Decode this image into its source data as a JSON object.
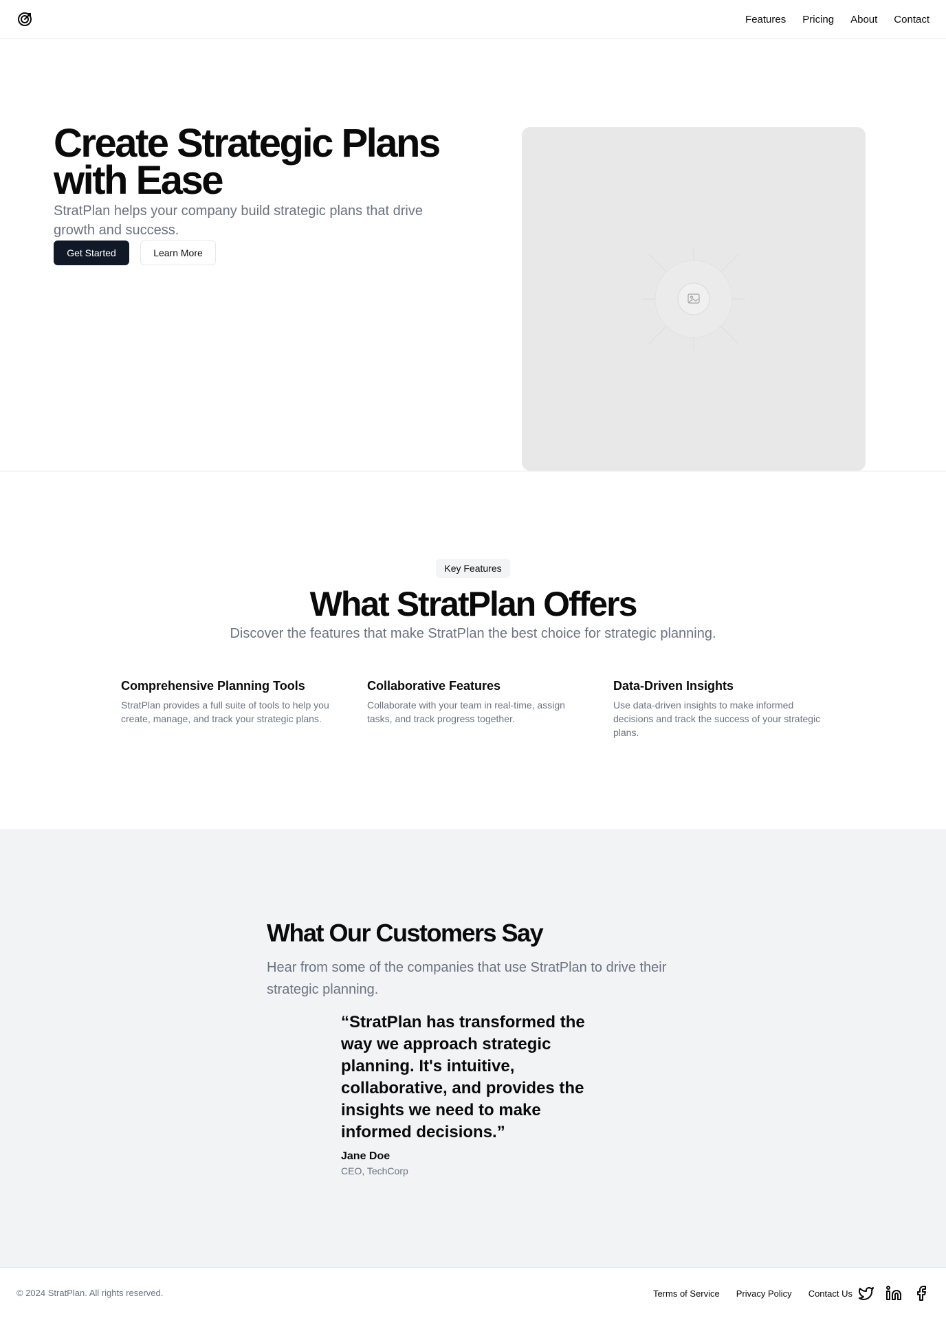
{
  "header": {
    "logo_icon": "crosshair-logo-icon",
    "nav": [
      "Features",
      "Pricing",
      "About",
      "Contact"
    ]
  },
  "hero": {
    "title": "Create Strategic Plans with Ease",
    "subtitle": "StratPlan helps your company build strategic plans that drive growth and success.",
    "primary_button": "Get Started",
    "secondary_button": "Learn More",
    "image_icon": "image-placeholder-icon"
  },
  "features": {
    "badge": "Key Features",
    "title": "What StratPlan Offers",
    "subtitle": "Discover the features that make StratPlan the best choice for strategic planning.",
    "items": [
      {
        "title": "Comprehensive Planning Tools",
        "description": "StratPlan provides a full suite of tools to help you create, manage, and track your strategic plans."
      },
      {
        "title": "Collaborative Features",
        "description": "Collaborate with your team in real-time, assign tasks, and track progress together."
      },
      {
        "title": "Data-Driven Insights",
        "description": "Use data-driven insights to make informed decisions and track the success of your strategic plans."
      }
    ]
  },
  "testimonials": {
    "title": "What Our Customers Say",
    "subtitle": "Hear from some of the companies that use StratPlan to drive their strategic planning.",
    "quote": "“StratPlan has transformed the way we approach strategic planning. It's intuitive, collaborative, and provides the insights we need to make informed decisions.”",
    "author": "Jane Doe",
    "role": "CEO, TechCorp"
  },
  "footer": {
    "copyright": "© 2024 StratPlan. All rights reserved.",
    "links": [
      "Terms of Service",
      "Privacy Policy",
      "Contact Us"
    ],
    "social_icons": [
      "twitter-icon",
      "linkedin-icon",
      "facebook-icon"
    ]
  },
  "colors": {
    "primary": "#111827",
    "muted_text": "#6b7280",
    "section_bg": "#f2f3f5",
    "placeholder_bg": "#e8e8e8"
  }
}
